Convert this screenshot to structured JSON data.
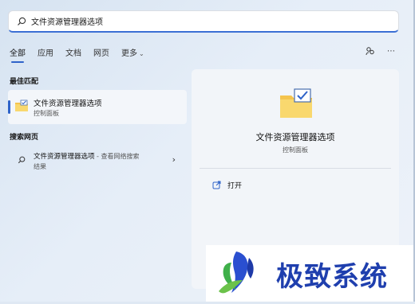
{
  "search": {
    "value": "文件资源管理器选项"
  },
  "tabs": [
    {
      "label": "全部"
    },
    {
      "label": "应用"
    },
    {
      "label": "文档"
    },
    {
      "label": "网页"
    },
    {
      "label": "更多"
    }
  ],
  "sections": {
    "best_match": "最佳匹配",
    "web_search": "搜索网页"
  },
  "best_match_item": {
    "title": "文件资源管理器选项",
    "subtitle": "控制面板"
  },
  "web_item": {
    "title": "文件资源管理器选项",
    "suffix": " - 查看网络搜索",
    "line2": "结果"
  },
  "detail": {
    "name": "文件资源管理器选项",
    "type": "控制面板",
    "action_open": "打开"
  },
  "watermark": {
    "text": "极致系统"
  },
  "colors": {
    "accent": "#2f63c9",
    "watermark_text": "#1f3fae"
  }
}
